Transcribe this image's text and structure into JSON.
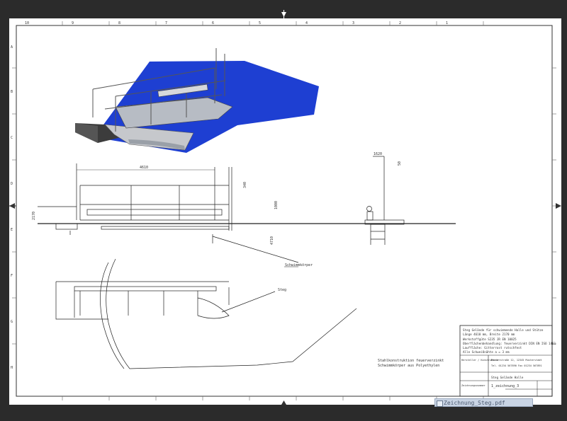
{
  "viewer": {
    "file_tab": "Zeichnung_Steg.pdf"
  },
  "frame": {
    "top_numbers": [
      "10",
      "9",
      "8",
      "7",
      "6",
      "5",
      "4",
      "3",
      "2",
      "1"
    ],
    "left_letters": [
      "A",
      "B",
      "C",
      "D",
      "E",
      "F",
      "G",
      "H"
    ]
  },
  "drawing": {
    "dim_top": "4610",
    "dim_left": "2170",
    "dim_height": "1000",
    "dim_small": "340",
    "dim_right_top": "1620",
    "dim_right_side": "4710",
    "dim_right_small": "50",
    "label_schwimmkoerper": "Schwimmkörper",
    "label_steg": "Steg",
    "note_line1": "Stahlkonstruktion feuerverzinkt",
    "note_line2": "Schwimmkörper aus Polyethylen"
  },
  "title_block": {
    "title_line1": "Steg Gelände für schwimmende Halle und Stütze",
    "title_line2": "Länge 4610 mm, Breite 2170 mm",
    "title_line3": "Werkstoffgüte S235 JR EN 10025",
    "title_line4": "Oberflächenbehandlung: feuerverzinkt DIN EN ISO 1461",
    "title_line5": "Lauffläche: Gitterrost rutschfest",
    "title_line6": "Alle Schweißnähte a = 3 mm",
    "company_block": "Hersteller / Konstrukteur",
    "company_address": "Musterstraße 12, 12345 Musterstadt",
    "company_contact": "Tel. 01234 567890 Fax 01234 567891",
    "drawing_name": "Steg Gelände Halle",
    "drawing_number": "1_zeichnung_3",
    "field_label": "Zeichnungsnummer"
  },
  "colors": {
    "float_blue": "#1e3fd2",
    "sheet_bg": "#ffffff",
    "frame_dark": "#2b2b2b"
  }
}
